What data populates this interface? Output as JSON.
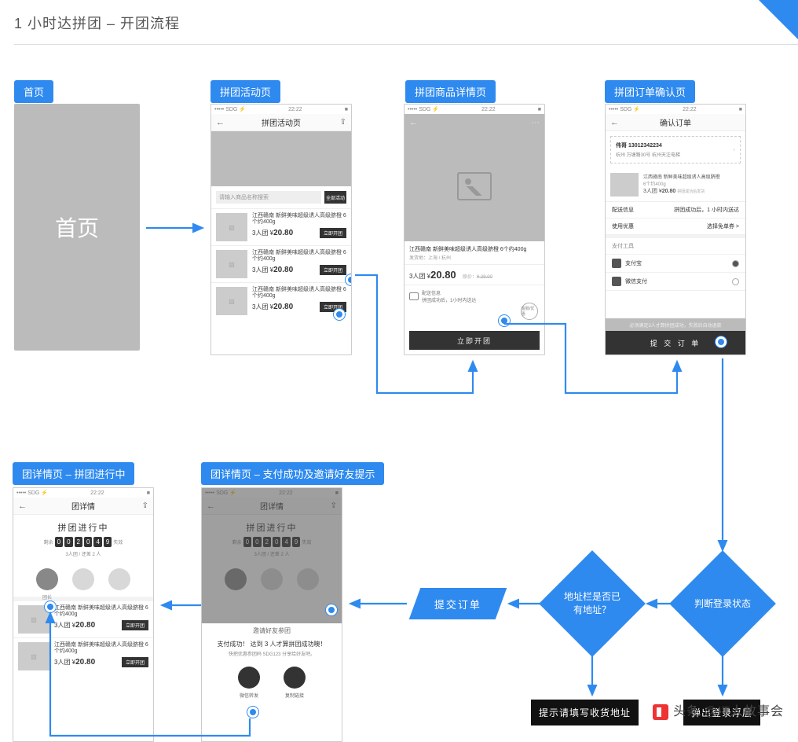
{
  "page_tag": "P3",
  "title": "1 小时达拼团 – 开团流程",
  "labels": {
    "home": "首页",
    "activity": "拼团活动页",
    "product": "拼团商品详情页",
    "confirm": "拼团订单确认页",
    "group_progress": "团详情页 – 拼团进行中",
    "group_success": "团详情页 – 支付成功及邀请好友提示"
  },
  "home_placeholder": "首页",
  "status": {
    "carrier": "••••• SDG ⚡",
    "time": "22:22",
    "batt": "■"
  },
  "activity": {
    "nav_title": "拼团活动页",
    "search_placeholder": "请输入商品名称搜索",
    "search_btn": "全部活动",
    "items": [
      {
        "name": "江西赣南 新鲜美味超级诱人高级脐橙 6个约400g",
        "price_prefix": "3人团 ¥",
        "price": "20.80",
        "btn": "立即开团"
      },
      {
        "name": "江西赣南 新鲜美味超级诱人高级脐橙 6个约400g",
        "price_prefix": "3人团 ¥",
        "price": "20.80",
        "btn": "立即开团"
      },
      {
        "name": "江西赣南 新鲜美味超级诱人高级脐橙 6个约400g",
        "price_prefix": "3人团 ¥",
        "price": "20.80",
        "btn": "立即开团"
      }
    ]
  },
  "product": {
    "nav_title": "",
    "name": "江西赣南 新鲜美味超级诱人高级脐橙 6个约400g",
    "sub": "发货地：上海 / 杭州",
    "price_prefix": "3人团 ¥",
    "price": "20.80",
    "old_label": "原价：",
    "old": "¥ 29.00",
    "ship_title": "配送信息",
    "ship_text": "拼团成功后，1小时内送达",
    "cs_label": "客服/优惠",
    "cta": "立即开团"
  },
  "confirm": {
    "nav_title": "确认订单",
    "addr_name": "伟哥 13012342234",
    "addr_detail": "杭州 万塘路30号 杭州天注电梯",
    "item_name": "江西赣南 新鲜美味超级诱人高级脐橙",
    "item_spec": "6个约400g",
    "item_price_prefix": "3人团 ¥",
    "item_price": "20.80",
    "item_note": "拼团成功后发货",
    "kv_ship_l": "配送信息",
    "kv_ship_r": "拼团成功后，1 小时内送达",
    "kv_coupon_l": "使用优惠",
    "kv_coupon_r": "选择免单券 >",
    "pay_section": "支付工具",
    "pay_alipay": "支付宝",
    "pay_wechat": "微信支付",
    "notice": "必须满足3人才算拼团成功，失败后自动退款",
    "submit": "提 交 订 单"
  },
  "group": {
    "nav_title": "团详情",
    "state": "拼团进行中",
    "cd_prefix": "剩余",
    "cd": [
      "0",
      "0",
      "2",
      "0",
      "4",
      "9"
    ],
    "cd_suffix": "失效",
    "count": "3人团 / 还差 2 人",
    "av_leader": "团长",
    "item_name": "江西赣南 新鲜美味超级诱人高级脐橙 6个约400g",
    "price_prefix": "3人团 ¥",
    "price": "20.80",
    "btn": "立即开团"
  },
  "success": {
    "invite_title": "邀请好友参团",
    "msg": "支付成功！ 达到 3 人才算拼团成功噢！",
    "sub": "快把优惠参团码 SDG123 分享给好友吧。",
    "btn_wechat": "微信转发",
    "btn_copy": "复制链接"
  },
  "flow": {
    "submit": "提交订单",
    "check_addr": "地址栏是否已\n有地址？",
    "check_login": "判断登录状态",
    "need_addr": "提示请填写收货地址",
    "need_login": "弹出登录浮层"
  },
  "watermark": "头条 @IT人故事会"
}
